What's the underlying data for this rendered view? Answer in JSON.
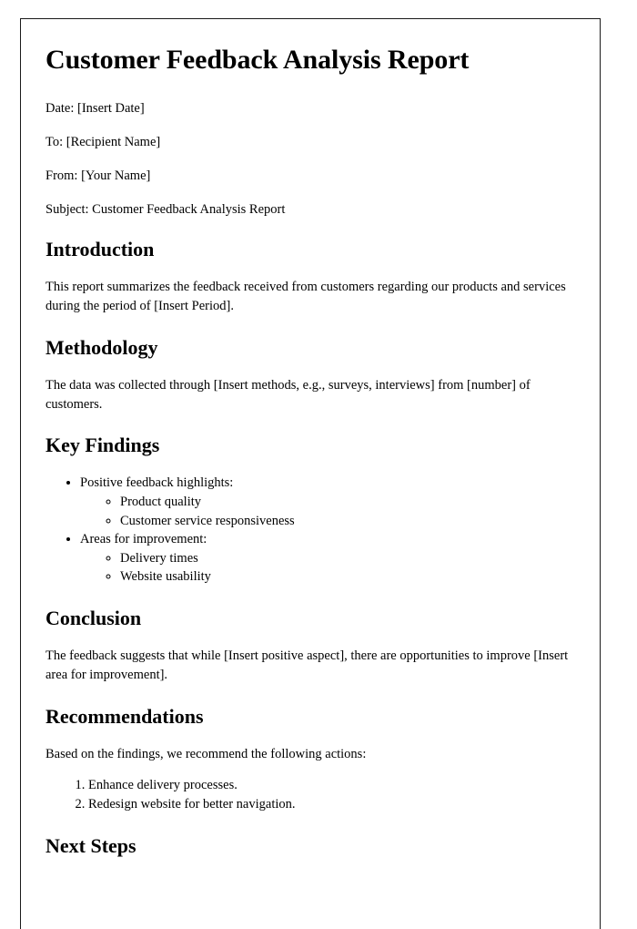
{
  "document": {
    "title": "Customer Feedback Analysis Report",
    "meta": [
      {
        "label": "Date",
        "text": "Date: [Insert Date]"
      },
      {
        "label": "To",
        "text": "To: [Recipient Name]"
      },
      {
        "label": "From",
        "text": "From: [Your Name]"
      },
      {
        "label": "Subject",
        "text": "Subject: Customer Feedback Analysis Report"
      }
    ],
    "sections": {
      "introduction": {
        "heading": "Introduction",
        "paragraph": "This report summarizes the feedback received from customers regarding our products and services during the period of [Insert Period]."
      },
      "methodology": {
        "heading": "Methodology",
        "paragraph": "The data was collected through [Insert methods, e.g., surveys, interviews] from [number] of customers."
      },
      "key_findings": {
        "heading": "Key Findings",
        "items": [
          {
            "text": "Positive feedback highlights:",
            "children": [
              "Product quality",
              "Customer service responsiveness"
            ]
          },
          {
            "text": "Areas for improvement:",
            "children": [
              "Delivery times",
              "Website usability"
            ]
          }
        ]
      },
      "conclusion": {
        "heading": "Conclusion",
        "paragraph": "The feedback suggests that while [Insert positive aspect], there are opportunities to improve [Insert area for improvement]."
      },
      "recommendations": {
        "heading": "Recommendations",
        "paragraph": "Based on the findings, we recommend the following actions:",
        "actions": [
          "Enhance delivery processes.",
          "Redesign website for better navigation."
        ]
      },
      "next_steps": {
        "heading": "Next Steps"
      }
    },
    "colors": {
      "text": "#000000",
      "page_border": "#1a1a1a",
      "background": "#ffffff"
    }
  }
}
